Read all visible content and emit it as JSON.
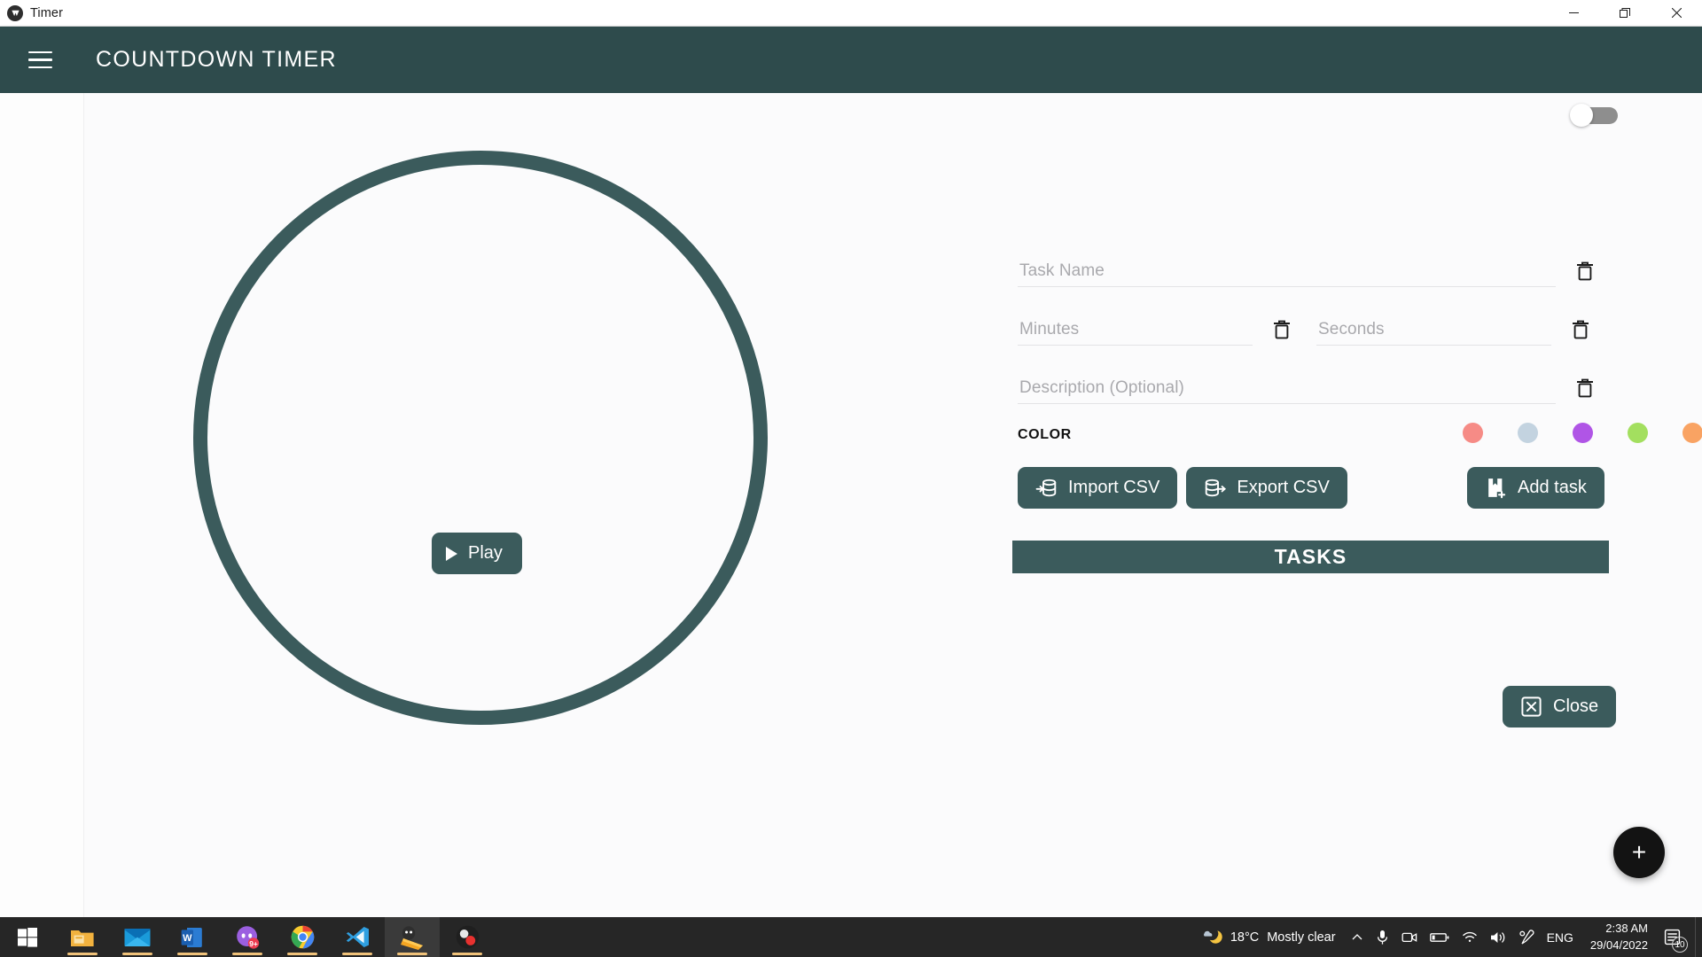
{
  "window": {
    "title": "Timer",
    "app_icon": "timer-app-icon",
    "minimize_label": "Minimize",
    "maximize_label": "Maximize",
    "close_label": "Close"
  },
  "appbar": {
    "menu_icon": "hamburger-menu-icon",
    "title": "COUNTDOWN TIMER"
  },
  "timer": {
    "play_label": "Play",
    "ring_color": "#3b5b5c"
  },
  "panel": {
    "toggle": {
      "name": "theme-toggle",
      "state": "off"
    },
    "fields": {
      "task_name": {
        "placeholder": "Task Name",
        "value": ""
      },
      "minutes": {
        "placeholder": "Minutes",
        "value": ""
      },
      "seconds": {
        "placeholder": "Seconds",
        "value": ""
      },
      "description": {
        "placeholder": "Description (Optional)",
        "value": ""
      }
    },
    "color_label": "COLOR",
    "colors": [
      "#f68b86",
      "#c3d3e0",
      "#b055e6",
      "#a3df5f",
      "#f9a363"
    ],
    "buttons": {
      "import_csv": "Import CSV",
      "export_csv": "Export CSV",
      "add_task": "Add task",
      "close": "Close"
    },
    "tasks_header": "TASKS",
    "tasks": []
  },
  "fab": {
    "label": "+"
  },
  "taskbar": {
    "items": [
      {
        "name": "start-button",
        "icon": "windows-logo-icon",
        "active": false,
        "underline": false
      },
      {
        "name": "file-explorer",
        "icon": "folder-icon",
        "active": false,
        "underline": true
      },
      {
        "name": "mail",
        "icon": "mail-icon",
        "active": false,
        "underline": true
      },
      {
        "name": "word",
        "icon": "word-icon",
        "active": false,
        "underline": true
      },
      {
        "name": "discord",
        "icon": "discord-icon",
        "active": false,
        "underline": true
      },
      {
        "name": "chrome",
        "icon": "chrome-icon",
        "active": false,
        "underline": true
      },
      {
        "name": "vscode",
        "icon": "vscode-icon",
        "active": false,
        "underline": true
      },
      {
        "name": "timer-app",
        "icon": "adventure-time-icon",
        "active": true,
        "underline": true
      },
      {
        "name": "obs-studio",
        "icon": "obs-icon",
        "active": false,
        "underline": true
      }
    ],
    "tray": {
      "weather_icon": "moon-cloud-icon",
      "temperature": "18°C",
      "condition": "Mostly clear",
      "chevron_icon": "chevron-up-icon",
      "mic_icon": "microphone-icon",
      "camera_icon": "camera-icon",
      "battery_icon": "battery-icon",
      "wifi_icon": "wifi-icon",
      "volume_icon": "speaker-icon",
      "pen_icon": "pen-icon",
      "language": "ENG",
      "time": "2:38 AM",
      "date": "29/04/2022",
      "notification_icon": "notification-icon",
      "notification_count": "10"
    }
  }
}
